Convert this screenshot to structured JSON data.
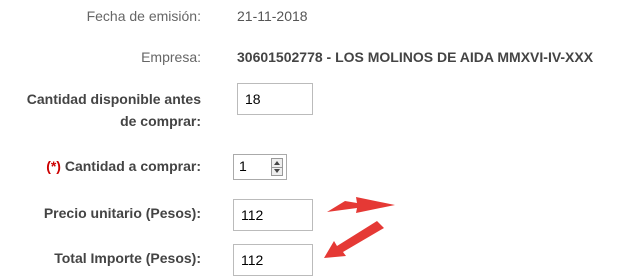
{
  "form": {
    "fecha_label": "Fecha de emisión:",
    "fecha_value": "21-11-2018",
    "empresa_label": "Empresa:",
    "empresa_value": "30601502778 - LOS MOLINOS DE AIDA MMXVI-IV-XXX",
    "cantidad_disp_label_line1": "Cantidad disponible antes",
    "cantidad_disp_label_line2": "de comprar:",
    "cantidad_disp_value": "18",
    "required_marker": "(*)",
    "cantidad_comprar_label": " Cantidad a comprar:",
    "cantidad_comprar_value": "1",
    "precio_label": "Precio unitario (Pesos):",
    "precio_value": "112",
    "total_label": "Total Importe (Pesos):",
    "total_value": "112"
  },
  "annotations": {
    "arrow_color": "#e53935",
    "arrow_icons": [
      "arrow-to-precio",
      "arrow-to-total"
    ]
  }
}
